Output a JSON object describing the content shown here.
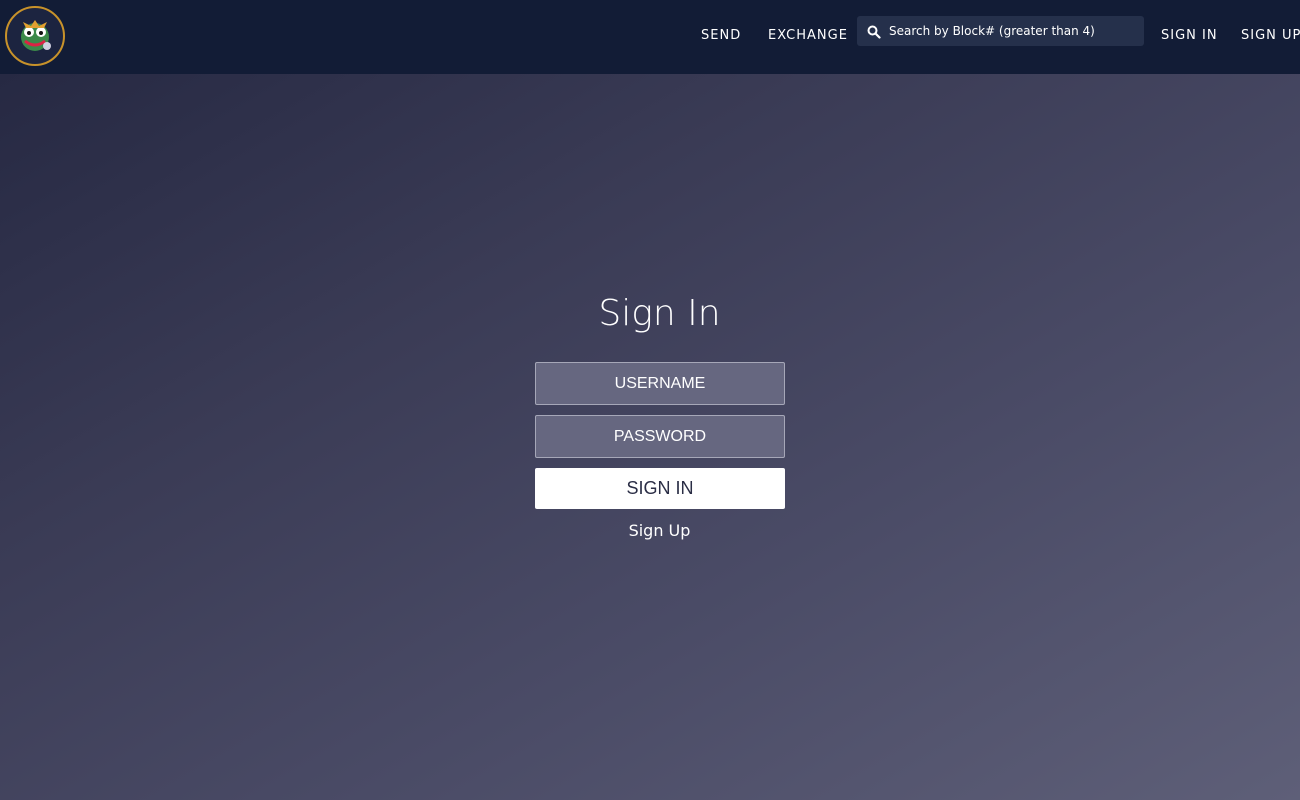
{
  "nav": {
    "logo_icon": "mascot-logo-icon",
    "links": {
      "send": "SEND",
      "exchange": "EXCHANGE",
      "sign_in": "SIGN IN",
      "sign_up": "SIGN UP"
    },
    "search": {
      "placeholder": "Search by Block# (greater than 4)",
      "icon": "search-icon"
    }
  },
  "form": {
    "title": "Sign In",
    "username_placeholder": "USERNAME",
    "password_placeholder": "PASSWORD",
    "submit_label": "SIGN IN",
    "signup_link": "Sign Up"
  },
  "colors": {
    "navbar_bg": "#121c36",
    "logo_ring": "#c8922a",
    "field_bg": "#666780",
    "button_bg": "#ffffff"
  }
}
